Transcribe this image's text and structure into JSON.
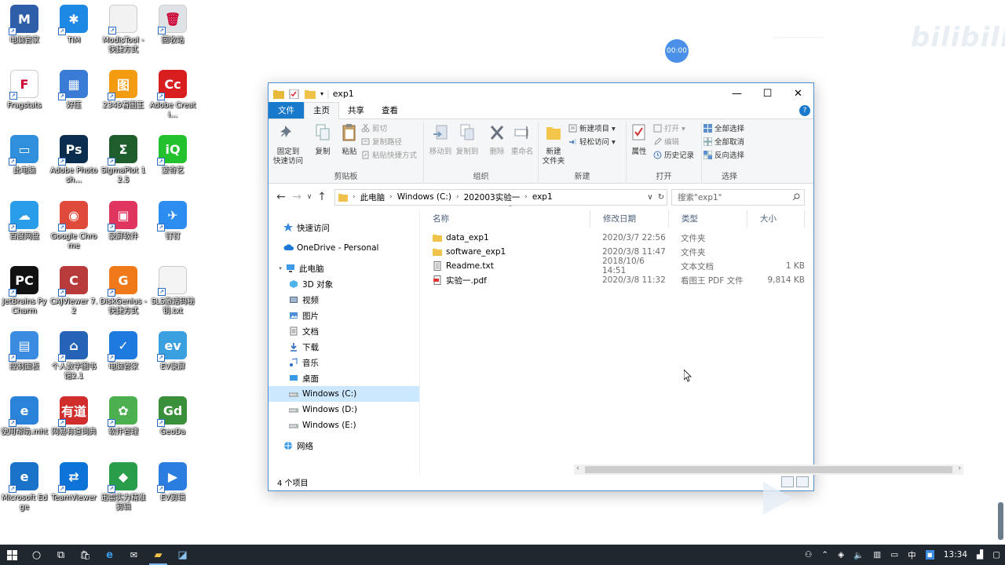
{
  "desktop": {
    "icons": [
      {
        "label": "电脑管家",
        "color": "#2e5ea8",
        "glyph": "M",
        "col": 0,
        "row": 0
      },
      {
        "label": "TIM",
        "color": "#1e88e5",
        "glyph": "✱",
        "col": 1,
        "row": 0
      },
      {
        "label": "ModisTool - 快捷方式",
        "color": "#f2f2f2",
        "glyph": "",
        "col": 2,
        "row": 0
      },
      {
        "label": "回收站",
        "color": "#dfe3e6",
        "glyph": "🗑",
        "col": 3,
        "row": 0
      },
      {
        "label": "Fragstats",
        "color": "#ffffff",
        "glyph": "F",
        "col": 0,
        "row": 1
      },
      {
        "label": "好压",
        "color": "#3a7bd5",
        "glyph": "▦",
        "col": 1,
        "row": 1
      },
      {
        "label": "2345看图王",
        "color": "#f39c12",
        "glyph": "图",
        "col": 2,
        "row": 1
      },
      {
        "label": "Adobe Creati...",
        "color": "#d81e1e",
        "glyph": "Cc",
        "col": 3,
        "row": 1
      },
      {
        "label": "此电脑",
        "color": "#2f8fdd",
        "glyph": "▭",
        "col": 0,
        "row": 2
      },
      {
        "label": "Adobe Photosh...",
        "color": "#0b2e4e",
        "glyph": "Ps",
        "col": 1,
        "row": 2
      },
      {
        "label": "SigmaPlot 12.5",
        "color": "#1f5e2c",
        "glyph": "Σ",
        "col": 2,
        "row": 2
      },
      {
        "label": "爱奇艺",
        "color": "#22c12d",
        "glyph": "iQ",
        "col": 3,
        "row": 2
      },
      {
        "label": "百度网盘",
        "color": "#2a9de8",
        "glyph": "☁",
        "col": 0,
        "row": 3
      },
      {
        "label": "Google Chrome",
        "color": "#e04a3a",
        "glyph": "◉",
        "col": 1,
        "row": 3
      },
      {
        "label": "录屏软件",
        "color": "#e0355e",
        "glyph": "▣",
        "col": 2,
        "row": 3
      },
      {
        "label": "钉钉",
        "color": "#2d8cf0",
        "glyph": "✈",
        "col": 3,
        "row": 3
      },
      {
        "label": "JetBrains PyCharm",
        "color": "#111111",
        "glyph": "PC",
        "col": 0,
        "row": 4
      },
      {
        "label": "CAJViewer 7.2",
        "color": "#b83a3a",
        "glyph": "C",
        "col": 1,
        "row": 4
      },
      {
        "label": "DiskGenius - 快捷方式",
        "color": "#f07a1a",
        "glyph": "G",
        "col": 2,
        "row": 4
      },
      {
        "label": "SLS激活码秘钥.txt",
        "color": "#f4f4f4",
        "glyph": "",
        "col": 3,
        "row": 4
      },
      {
        "label": "控制面板",
        "color": "#3b8be0",
        "glyph": "▤",
        "col": 0,
        "row": 5
      },
      {
        "label": "个人数字图书馆2.1",
        "color": "#2463b6",
        "glyph": "⌂",
        "col": 1,
        "row": 5
      },
      {
        "label": "电脑管家",
        "color": "#1f7ae0",
        "glyph": "✓",
        "col": 2,
        "row": 5
      },
      {
        "label": "EV录屏",
        "color": "#3aa0e0",
        "glyph": "ev",
        "col": 3,
        "row": 5
      },
      {
        "label": "使用帮助.mht",
        "color": "#2a83d8",
        "glyph": "e",
        "col": 0,
        "row": 6
      },
      {
        "label": "网易有道词典",
        "color": "#d22d2d",
        "glyph": "有道",
        "col": 1,
        "row": 6
      },
      {
        "label": "软件管理",
        "color": "#4caf50",
        "glyph": "✿",
        "col": 2,
        "row": 6
      },
      {
        "label": "GeoDa",
        "color": "#3a8f3a",
        "glyph": "Gd",
        "col": 3,
        "row": 6
      },
      {
        "label": "Microsoft Edge",
        "color": "#1a73c9",
        "glyph": "e",
        "col": 0,
        "row": 7
      },
      {
        "label": "TeamViewer",
        "color": "#0e73d6",
        "glyph": "⇄",
        "col": 1,
        "row": 7
      },
      {
        "label": "迅雷实力精准剪辑",
        "color": "#2a9d4a",
        "glyph": "◆",
        "col": 2,
        "row": 7
      },
      {
        "label": "EV剪辑",
        "color": "#2c7de0",
        "glyph": "▶",
        "col": 3,
        "row": 7
      }
    ]
  },
  "overlay": {
    "timer": "00:00",
    "watermark": "bilibili"
  },
  "window": {
    "title": "exp1",
    "controls": {
      "minimize": "—",
      "maximize": "☐",
      "close": "✕"
    },
    "tabs": {
      "file": "文件",
      "home": "主页",
      "share": "共享",
      "view": "查看",
      "help": "?"
    },
    "ribbon": {
      "clipboard": {
        "label": "剪贴板",
        "pin": "固定到\n快速访问",
        "copy": "复制",
        "paste": "粘贴",
        "cut": "剪切",
        "copy_path": "复制路径",
        "paste_shortcut": "粘贴快捷方式"
      },
      "organize": {
        "label": "组织",
        "move_to": "移动到",
        "copy_to": "复制到",
        "delete": "删除",
        "rename": "重命名"
      },
      "new": {
        "label": "新建",
        "new_folder": "新建\n文件夹",
        "new_item": "新建项目 ▾",
        "easy_access": "轻松访问 ▾"
      },
      "open": {
        "label": "打开",
        "properties": "属性",
        "open": "打开 ▾",
        "edit": "编辑",
        "history": "历史记录"
      },
      "select": {
        "label": "选择",
        "select_all": "全部选择",
        "select_none": "全部取消",
        "invert": "反向选择"
      }
    },
    "address": {
      "back": "←",
      "forward": "→",
      "recent": "∨",
      "up": "↑",
      "crumbs": [
        "此电脑",
        "Windows (C:)",
        "202003实验一",
        "exp1"
      ],
      "dropdown": "∨",
      "refresh": "↻",
      "search_placeholder": "搜索\"exp1\""
    },
    "nav": {
      "items": [
        {
          "label": "快速访问",
          "indent": 0,
          "icon": "star",
          "gap_after": true
        },
        {
          "label": "OneDrive - Personal",
          "indent": 0,
          "icon": "cloud",
          "gap_after": true
        },
        {
          "label": "此电脑",
          "indent": 0,
          "icon": "pc",
          "expanded": true
        },
        {
          "label": "3D 对象",
          "indent": 1,
          "icon": "cube"
        },
        {
          "label": "视频",
          "indent": 1,
          "icon": "video"
        },
        {
          "label": "图片",
          "indent": 1,
          "icon": "picture"
        },
        {
          "label": "文档",
          "indent": 1,
          "icon": "document"
        },
        {
          "label": "下载",
          "indent": 1,
          "icon": "download"
        },
        {
          "label": "音乐",
          "indent": 1,
          "icon": "music"
        },
        {
          "label": "桌面",
          "indent": 1,
          "icon": "desktop"
        },
        {
          "label": "Windows (C:)",
          "indent": 1,
          "icon": "drive",
          "selected": true
        },
        {
          "label": "Windows (D:)",
          "indent": 1,
          "icon": "drive"
        },
        {
          "label": "Windows (E:)",
          "indent": 1,
          "icon": "drive",
          "gap_after": true
        },
        {
          "label": "网络",
          "indent": 0,
          "icon": "network"
        }
      ]
    },
    "files": {
      "columns": [
        "名称",
        "修改日期",
        "类型",
        "大小"
      ],
      "rows": [
        {
          "name": "data_exp1",
          "date": "2020/3/7 22:56",
          "type": "文件夹",
          "size": "",
          "icon": "folder"
        },
        {
          "name": "software_exp1",
          "date": "2020/3/8 11:47",
          "type": "文件夹",
          "size": "",
          "icon": "folder"
        },
        {
          "name": "Readme.txt",
          "date": "2018/10/6 14:51",
          "type": "文本文档",
          "size": "1 KB",
          "icon": "text"
        },
        {
          "name": "实验一.pdf",
          "date": "2020/3/8 11:32",
          "type": "看图王 PDF 文件",
          "size": "9,814 KB",
          "icon": "pdf"
        }
      ]
    },
    "status": "4 个项目"
  },
  "taskbar": {
    "clock": "13:34",
    "ime": "中",
    "tray_icons": [
      "person-icon",
      "chevron-up-icon",
      "shield-icon",
      "volume-icon",
      "network-icon",
      "battery-icon",
      "ime-icon",
      "notification-icon"
    ]
  },
  "colors": {
    "accent": "#1979ca",
    "selection": "#cce8ff",
    "taskbar": "#20272e"
  }
}
